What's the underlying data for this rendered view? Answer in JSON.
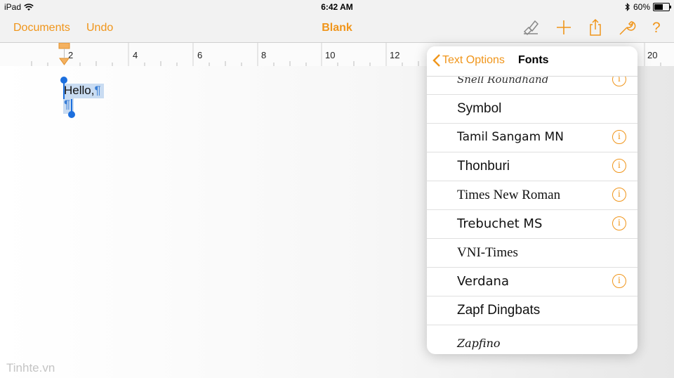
{
  "status_bar": {
    "device": "iPad",
    "time": "6:42 AM",
    "battery": "60%",
    "battery_level": 0.6
  },
  "navbar": {
    "documents_label": "Documents",
    "undo_label": "Undo",
    "title": "Blank",
    "icons": [
      "paintbrush-icon",
      "plus-icon",
      "share-icon",
      "wrench-icon",
      "help-icon"
    ],
    "help_label": "?"
  },
  "ruler": {
    "labels": [
      "2",
      "4",
      "6",
      "8",
      "10",
      "12",
      "20"
    ]
  },
  "document": {
    "text": "Hello,",
    "pilcrow": "¶"
  },
  "popover": {
    "back_label": "Text Options",
    "title": "Fonts",
    "fonts": [
      {
        "name": "Snell Roundhand",
        "info": true
      },
      {
        "name": "Symbol",
        "info": false
      },
      {
        "name": "Tamil Sangam MN",
        "info": true
      },
      {
        "name": "Thonburi",
        "info": true
      },
      {
        "name": "Times New Roman",
        "info": true
      },
      {
        "name": "Trebuchet MS",
        "info": true
      },
      {
        "name": "VNI-Times",
        "info": false
      },
      {
        "name": "Verdana",
        "info": true
      },
      {
        "name": "Zapf Dingbats",
        "info": false
      },
      {
        "name": "Zapfino",
        "info": false
      }
    ]
  },
  "watermark": "Tinhte.vn",
  "colors": {
    "accent": "#f0951a",
    "selection": "#c9dcf2",
    "handle": "#1c6fde"
  }
}
